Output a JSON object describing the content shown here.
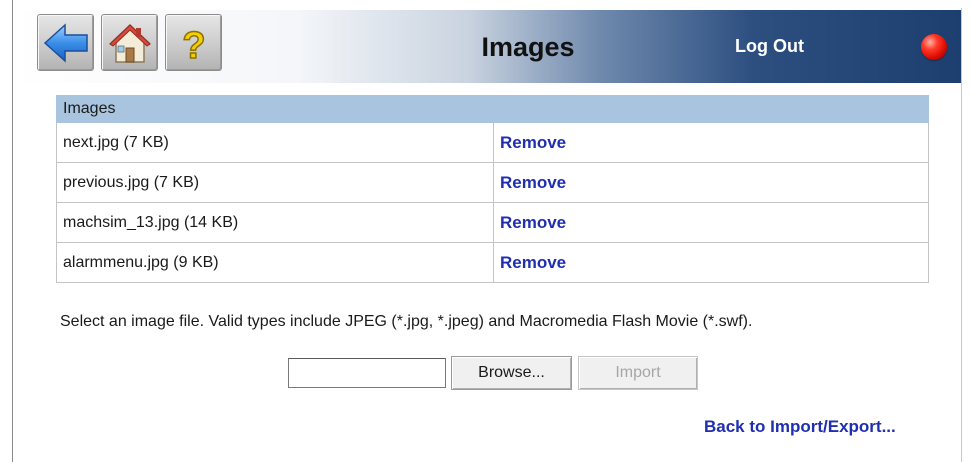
{
  "header": {
    "title": "Images",
    "logout_label": "Log Out",
    "status_color": "#e01b0b",
    "nav_buttons": [
      {
        "icon": "back-arrow-icon"
      },
      {
        "icon": "home-icon"
      },
      {
        "icon": "help-icon",
        "glyph": "?"
      }
    ]
  },
  "table": {
    "header": "Images",
    "rows": [
      {
        "file": "next.jpg (7 KB)",
        "action": "Remove"
      },
      {
        "file": "previous.jpg (7 KB)",
        "action": "Remove"
      },
      {
        "file": "machsim_13.jpg (14 KB)",
        "action": "Remove"
      },
      {
        "file": "alarmmenu.jpg (9 KB)",
        "action": "Remove"
      }
    ]
  },
  "upload": {
    "instructions": "Select an image file. Valid types include JPEG (*.jpg, *.jpeg) and Macromedia Flash Movie (*.swf).",
    "file_value": "",
    "browse_label": "Browse...",
    "import_label": "Import"
  },
  "footer": {
    "back_link": "Back to Import/Export..."
  },
  "colors": {
    "link": "#1f2fb0",
    "table_header_bg": "#a8c4df",
    "header_gradient_dark": "#1d3f6f"
  }
}
